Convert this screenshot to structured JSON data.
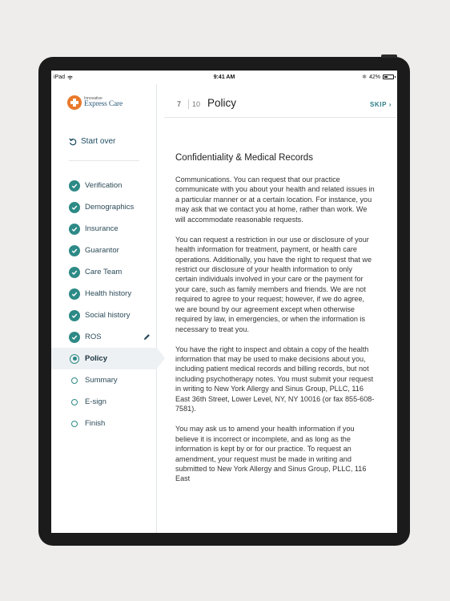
{
  "status_bar": {
    "device": "iPad",
    "time": "9:41 AM",
    "battery": "42%",
    "battery_level": 0.42
  },
  "sidebar": {
    "logo": {
      "small_text": "Innovative",
      "main_text": "Express Care"
    },
    "start_over": "Start over",
    "steps": [
      {
        "label": "Verification",
        "state": "done"
      },
      {
        "label": "Demographics",
        "state": "done"
      },
      {
        "label": "Insurance",
        "state": "done"
      },
      {
        "label": "Guarantor",
        "state": "done"
      },
      {
        "label": "Care Team",
        "state": "done"
      },
      {
        "label": "Health history",
        "state": "done"
      },
      {
        "label": "Social history",
        "state": "done"
      },
      {
        "label": "ROS",
        "state": "done"
      },
      {
        "label": "Policy",
        "state": "current"
      },
      {
        "label": "Summary",
        "state": "todo"
      },
      {
        "label": "E-sign",
        "state": "todo"
      },
      {
        "label": "Finish",
        "state": "todo"
      }
    ]
  },
  "header": {
    "step_number": "7",
    "step_total": "10",
    "title": "Policy",
    "skip_label": "SKIP"
  },
  "content": {
    "section_title": "Confidentiality & Medical Records",
    "paragraphs": [
      "Communications. You can request that our practice communicate with you about your health and related issues in a particular manner or at a certain location. For instance, you may ask that we contact you at home, rather than work. We will accommodate reasonable requests.",
      "You can request a restriction in our use or disclosure of your health information for treatment, payment, or health care operations. Additionally, you have the right to request that we restrict our disclosure of your health information to only certain individuals involved in your care or the payment for your care, such as family members and friends. We are not required to agree to your request; however, if we do agree, we are bound by our agreement except when otherwise required by law, in emergencies, or when the information is necessary to treat you.",
      "You have the right to inspect and obtain a copy of the health information that may be used to make decisions about you, including patient medical records and billing records, but not including psychotherapy notes. You must submit your request in writing to New York Allergy and Sinus Group, PLLC, 116 East 36th Street, Lower Level, NY, NY 10016 (or fax 855-608-7581).",
      "You may ask us to amend your health information if you believe it is incorrect or incomplete, and as long as the information is kept by or for our practice. To request an amendment, your request must be made in writing and submitted to New York Allergy and Sinus Group, PLLC, 116 East"
    ]
  },
  "colors": {
    "accent": "#2d8a86",
    "logo_orange": "#e8792a",
    "logo_blue": "#2c5b78",
    "active_row": "#eef1f3"
  }
}
